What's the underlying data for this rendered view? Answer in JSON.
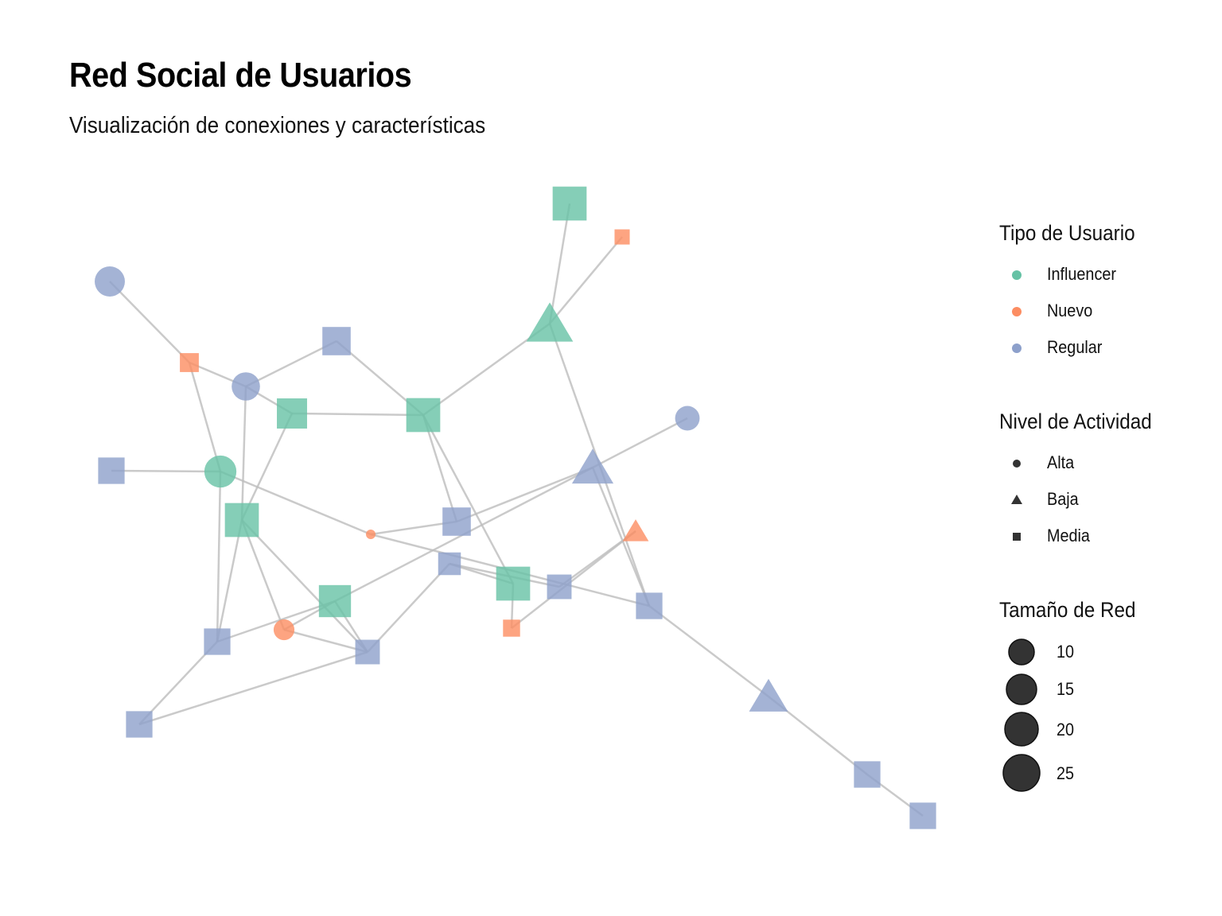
{
  "title": "Red Social de Usuarios",
  "subtitle": "Visualización de conexiones y características",
  "colors": {
    "Influencer": "#66c2a5",
    "Nuevo": "#fc8d62",
    "Regular": "#8da0cb",
    "edge": "#bdbdbd",
    "legend_shape": "#333333"
  },
  "legend": {
    "tipo": {
      "title": "Tipo de Usuario",
      "items": [
        "Influencer",
        "Nuevo",
        "Regular"
      ]
    },
    "actividad": {
      "title": "Nivel de Actividad",
      "items": [
        {
          "label": "Alta",
          "shape": "circle"
        },
        {
          "label": "Baja",
          "shape": "triangle"
        },
        {
          "label": "Media",
          "shape": "square"
        }
      ]
    },
    "tamano": {
      "title": "Tamaño de Red",
      "items": [
        "10",
        "15",
        "20",
        "25"
      ]
    }
  },
  "graph": {
    "node_shapes": {
      "Alta": "circle",
      "Baja": "triangle",
      "Media": "square"
    },
    "nodes": [
      {
        "id": "n1",
        "tipo": "Regular",
        "actividad": "Alta",
        "red": 20
      },
      {
        "id": "n2",
        "tipo": "Nuevo",
        "actividad": "Media",
        "red": 14
      },
      {
        "id": "n3",
        "tipo": "Regular",
        "actividad": "Alta",
        "red": 19
      },
      {
        "id": "n4",
        "tipo": "Regular",
        "actividad": "Media",
        "red": 19
      },
      {
        "id": "n5",
        "tipo": "Influencer",
        "actividad": "Media",
        "red": 20
      },
      {
        "id": "n6",
        "tipo": "Influencer",
        "actividad": "Media",
        "red": 22
      },
      {
        "id": "n7",
        "tipo": "Influencer",
        "actividad": "Media",
        "red": 22
      },
      {
        "id": "n8",
        "tipo": "Nuevo",
        "actividad": "Media",
        "red": 12
      },
      {
        "id": "n9",
        "tipo": "Influencer",
        "actividad": "Baja",
        "red": 22
      },
      {
        "id": "n10",
        "tipo": "Regular",
        "actividad": "Alta",
        "red": 17
      },
      {
        "id": "n11",
        "tipo": "Regular",
        "actividad": "Media",
        "red": 18
      },
      {
        "id": "n12",
        "tipo": "Influencer",
        "actividad": "Alta",
        "red": 21
      },
      {
        "id": "n13",
        "tipo": "Regular",
        "actividad": "Baja",
        "red": 20
      },
      {
        "id": "n14",
        "tipo": "Influencer",
        "actividad": "Media",
        "red": 22
      },
      {
        "id": "n15",
        "tipo": "Nuevo",
        "actividad": "Alta",
        "red": 9
      },
      {
        "id": "n16",
        "tipo": "Regular",
        "actividad": "Media",
        "red": 19
      },
      {
        "id": "n17",
        "tipo": "Nuevo",
        "actividad": "Baja",
        "red": 14
      },
      {
        "id": "n18",
        "tipo": "Regular",
        "actividad": "Media",
        "red": 16
      },
      {
        "id": "n19",
        "tipo": "Influencer",
        "actividad": "Media",
        "red": 22
      },
      {
        "id": "n20",
        "tipo": "Regular",
        "actividad": "Media",
        "red": 17
      },
      {
        "id": "n21",
        "tipo": "Regular",
        "actividad": "Media",
        "red": 18
      },
      {
        "id": "n22",
        "tipo": "Influencer",
        "actividad": "Media",
        "red": 21
      },
      {
        "id": "n23",
        "tipo": "Nuevo",
        "actividad": "Media",
        "red": 13
      },
      {
        "id": "n24",
        "tipo": "Regular",
        "actividad": "Media",
        "red": 18
      },
      {
        "id": "n25",
        "tipo": "Nuevo",
        "actividad": "Alta",
        "red": 15
      },
      {
        "id": "n26",
        "tipo": "Regular",
        "actividad": "Media",
        "red": 17
      },
      {
        "id": "n27",
        "tipo": "Regular",
        "actividad": "Media",
        "red": 18
      },
      {
        "id": "n28",
        "tipo": "Regular",
        "actividad": "Baja",
        "red": 19
      },
      {
        "id": "n29",
        "tipo": "Regular",
        "actividad": "Media",
        "red": 18
      },
      {
        "id": "n30",
        "tipo": "Regular",
        "actividad": "Media",
        "red": 18
      }
    ],
    "edges": [
      [
        "n1",
        "n2"
      ],
      [
        "n2",
        "n3"
      ],
      [
        "n2",
        "n12"
      ],
      [
        "n3",
        "n4"
      ],
      [
        "n3",
        "n5"
      ],
      [
        "n3",
        "n14"
      ],
      [
        "n4",
        "n7"
      ],
      [
        "n5",
        "n7"
      ],
      [
        "n7",
        "n9"
      ],
      [
        "n9",
        "n6"
      ],
      [
        "n9",
        "n8"
      ],
      [
        "n9",
        "n21"
      ],
      [
        "n11",
        "n12"
      ],
      [
        "n12",
        "n15"
      ],
      [
        "n15",
        "n16"
      ],
      [
        "n15",
        "n21"
      ],
      [
        "n16",
        "n13"
      ],
      [
        "n13",
        "n10"
      ],
      [
        "n13",
        "n21"
      ],
      [
        "n14",
        "n25"
      ],
      [
        "n14",
        "n26"
      ],
      [
        "n5",
        "n14"
      ],
      [
        "n7",
        "n16"
      ],
      [
        "n7",
        "n19"
      ],
      [
        "n19",
        "n23"
      ],
      [
        "n23",
        "n17"
      ],
      [
        "n17",
        "n20"
      ],
      [
        "n18",
        "n20"
      ],
      [
        "n18",
        "n26"
      ],
      [
        "n18",
        "n19"
      ],
      [
        "n25",
        "n22"
      ],
      [
        "n25",
        "n26"
      ],
      [
        "n22",
        "n13"
      ],
      [
        "n22",
        "n26"
      ],
      [
        "n27",
        "n26"
      ],
      [
        "n21",
        "n28"
      ],
      [
        "n28",
        "n29"
      ],
      [
        "n29",
        "n30"
      ]
    ]
  }
}
